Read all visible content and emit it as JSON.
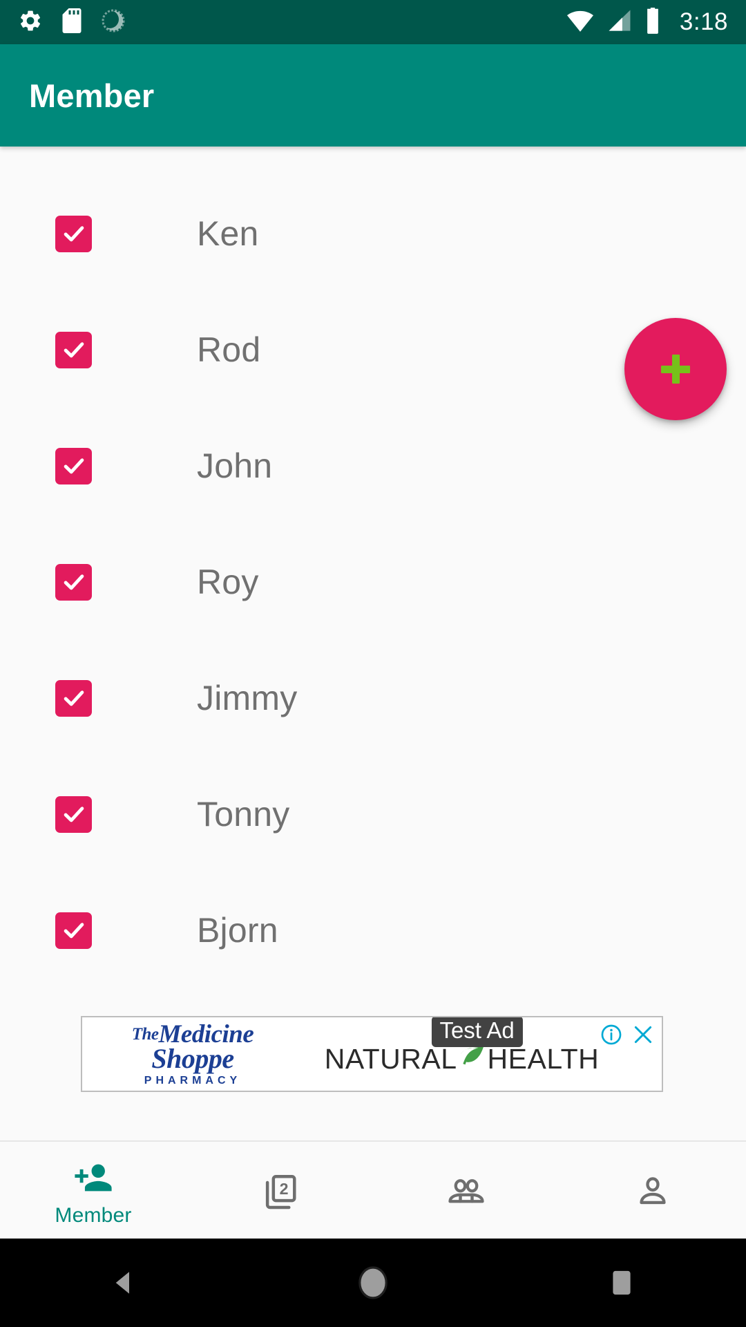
{
  "status_bar": {
    "time": "3:18",
    "left_icons": [
      "settings-gear-icon",
      "sd-card-icon",
      "sync-progress-icon"
    ],
    "right_icons": [
      "wifi-icon",
      "cellular-signal-icon",
      "battery-icon"
    ],
    "background_color": "#00574B"
  },
  "app_bar": {
    "title": "Member",
    "background_color": "#00897B",
    "title_color": "#FFFFFF"
  },
  "fab": {
    "icon": "plus-icon",
    "label": "+",
    "background_color": "#E31B5D",
    "icon_color": "#76C11A"
  },
  "members": [
    {
      "name": "Ken",
      "checked": true
    },
    {
      "name": "Rod",
      "checked": true
    },
    {
      "name": "John",
      "checked": true
    },
    {
      "name": "Roy",
      "checked": true
    },
    {
      "name": "Jimmy",
      "checked": true
    },
    {
      "name": "Tonny",
      "checked": true
    },
    {
      "name": "Bjorn",
      "checked": true
    }
  ],
  "list_style": {
    "checkbox_color": "#E21B5D",
    "name_color": "#707070"
  },
  "ad": {
    "badge": "Test Ad",
    "logo_the": "The",
    "logo_line1": "Medicine",
    "logo_line2": "Shoppe",
    "logo_line3": "PHARMACY",
    "headline_left": "NATURAL",
    "headline_right": "HEALTH",
    "info_icon": "info-icon",
    "close_icon": "close-icon",
    "control_color": "#00A9D4",
    "logo_color": "#1C3F94"
  },
  "bottom_nav": {
    "active_color": "#00897B",
    "inactive_color": "#6E6E6E",
    "items": [
      {
        "label": "Member",
        "icon": "person-add-icon",
        "active": true
      },
      {
        "label": "",
        "icon": "filter-2-icon",
        "active": false
      },
      {
        "label": "",
        "icon": "people-icon",
        "active": false
      },
      {
        "label": "",
        "icon": "person-icon",
        "active": false
      }
    ]
  },
  "android_nav": {
    "back": "back-triangle-icon",
    "home": "home-circle-icon",
    "recents": "recents-square-icon",
    "background_color": "#000000"
  }
}
